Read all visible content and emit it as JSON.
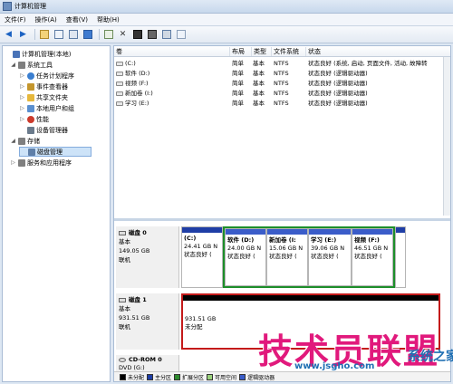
{
  "window": {
    "title": "计算机管理"
  },
  "menu": [
    "文件(F)",
    "操作(A)",
    "查看(V)",
    "帮助(H)"
  ],
  "toolbar": [
    "back-arrow-icon",
    "forward-arrow-icon",
    "folder-up-icon",
    "show-tree-icon",
    "properties-icon",
    "help-icon",
    "refresh-icon",
    "delete-icon",
    "disk-icon",
    "format-icon",
    "search-icon",
    "settings-icon"
  ],
  "tree": [
    {
      "label": "计算机管理(本地)",
      "level": 0,
      "expand": "",
      "icon": "computer-icon",
      "color": "#4a74b8"
    },
    {
      "label": "系统工具",
      "level": 1,
      "expand": "◢",
      "icon": "tools-icon",
      "color": "#7f7f7f"
    },
    {
      "label": "任务计划程序",
      "level": 2,
      "expand": "▷",
      "icon": "clock-icon",
      "color": "#3b7fd0"
    },
    {
      "label": "事件查看器",
      "level": 2,
      "expand": "▷",
      "icon": "event-icon",
      "color": "#c4962d"
    },
    {
      "label": "共享文件夹",
      "level": 2,
      "expand": "▷",
      "icon": "folder-icon",
      "color": "#e6b83c"
    },
    {
      "label": "本地用户和组",
      "level": 2,
      "expand": "▷",
      "icon": "users-icon",
      "color": "#5a8fcf"
    },
    {
      "label": "性能",
      "level": 2,
      "expand": "▷",
      "icon": "performance-icon",
      "color": "#cc3a2b"
    },
    {
      "label": "设备管理器",
      "level": 2,
      "expand": "",
      "icon": "device-icon",
      "color": "#6b7b8c"
    },
    {
      "label": "存储",
      "level": 1,
      "expand": "◢",
      "icon": "storage-icon",
      "color": "#7f7f7f"
    },
    {
      "label": "磁盘管理",
      "level": 2,
      "expand": "",
      "icon": "disk-mgmt-icon",
      "color": "#5f7fa8",
      "selected": true
    },
    {
      "label": "服务和应用程序",
      "level": 1,
      "expand": "▷",
      "icon": "services-icon",
      "color": "#7f7f7f"
    }
  ],
  "columns": [
    "卷",
    "布局",
    "类型",
    "文件系统",
    "状态"
  ],
  "volumes": [
    {
      "name": "(C:)",
      "layout": "简单",
      "type": "基本",
      "fs": "NTFS",
      "status": "状态良好 (系统, 启动, 页面文件, 活动, 故障转"
    },
    {
      "name": "软件 (D:)",
      "layout": "简单",
      "type": "基本",
      "fs": "NTFS",
      "status": "状态良好 (逻辑驱动器)"
    },
    {
      "name": "视频 (F:)",
      "layout": "简单",
      "type": "基本",
      "fs": "NTFS",
      "status": "状态良好 (逻辑驱动器)"
    },
    {
      "name": "新加卷 (I:)",
      "layout": "简单",
      "type": "基本",
      "fs": "NTFS",
      "status": "状态良好 (逻辑驱动器)"
    },
    {
      "name": "学习 (E:)",
      "layout": "简单",
      "type": "基本",
      "fs": "NTFS",
      "status": "状态良好 (逻辑驱动器)"
    }
  ],
  "disk0": {
    "name": "磁盘 0",
    "type": "基本",
    "size": "149.05 GB",
    "status": "联机",
    "partitions": [
      {
        "name": "(C:)",
        "size": "24.41 GB N",
        "status": "状态良好 ("
      },
      {
        "name": "软件 (D:)",
        "size": "24.00 GB N",
        "status": "状态良好 ("
      },
      {
        "name": "新加卷 (I:",
        "size": "15.06 GB N",
        "status": "状态良好 ("
      },
      {
        "name": "学习 (E:)",
        "size": "39.06 GB N",
        "status": "状态良好 ("
      },
      {
        "name": "视频 (F:)",
        "size": "46.51 GB N",
        "status": "状态良好 ("
      }
    ]
  },
  "disk1": {
    "name": "磁盘 1",
    "type": "基本",
    "size": "931.51 GB",
    "status": "联机",
    "unalloc_size": "931.51 GB",
    "unalloc_label": "未分配"
  },
  "cdrom": {
    "name": "CD-ROM 0",
    "type": "DVD (G:)"
  },
  "legend": [
    {
      "label": "未分配",
      "color": "#000000"
    },
    {
      "label": "主分区",
      "color": "#1f3ea6"
    },
    {
      "label": "扩展分区",
      "color": "#2e8b2e"
    },
    {
      "label": "可用空间",
      "color": "#9ad27c"
    },
    {
      "label": "逻辑驱动器",
      "color": "#3a5cc9"
    }
  ],
  "watermark": {
    "main": "技术员联盟",
    "url": "www.jsgho.com",
    "mark": "系统之家"
  },
  "colors": {
    "selection_green": "#1d8f2a",
    "unallocated_red": "#c41a1a",
    "partition_bar": "#1f3ea6"
  }
}
